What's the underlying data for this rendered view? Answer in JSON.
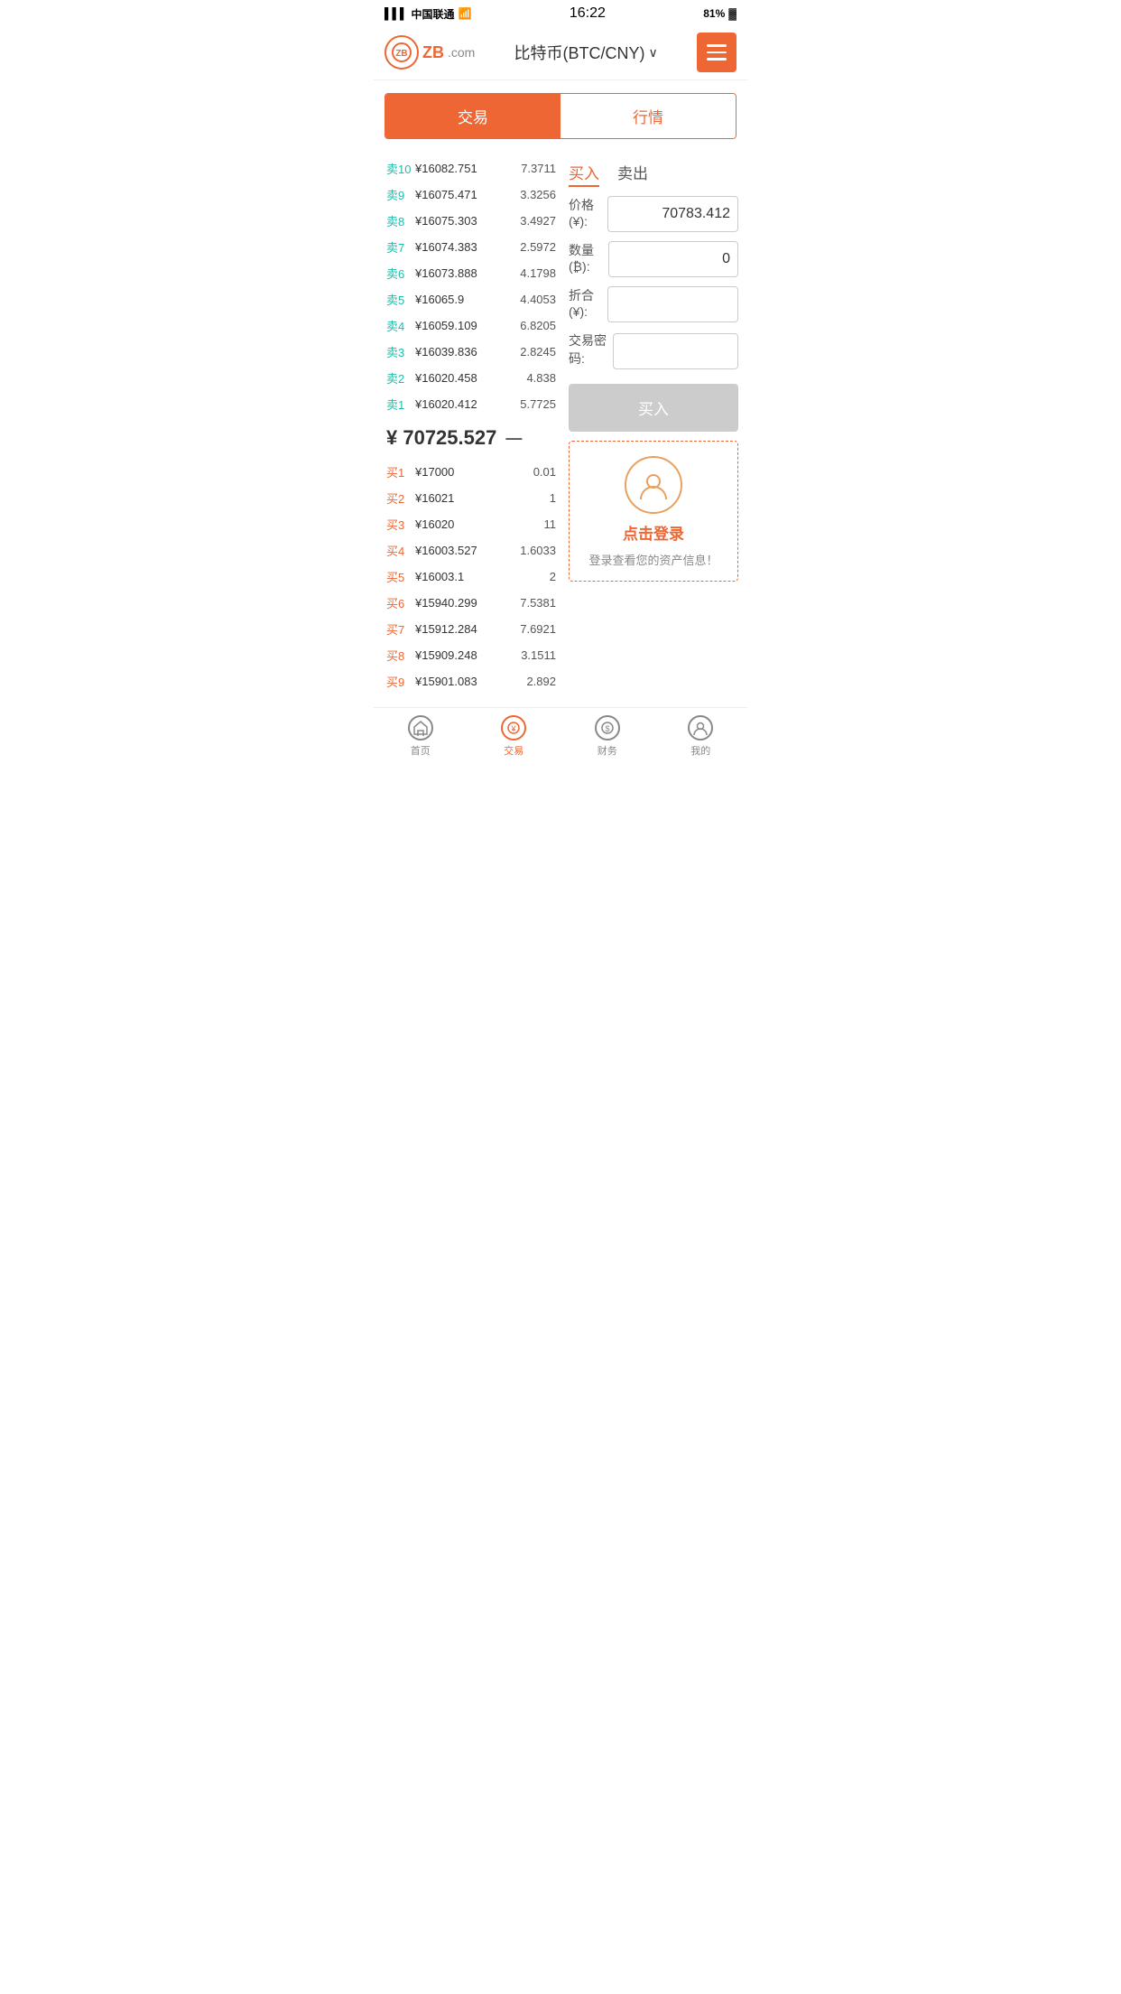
{
  "statusBar": {
    "carrier": "中国联通",
    "time": "16:22",
    "battery": "81%"
  },
  "header": {
    "logo": "ZB",
    "logoSuffix": ".com",
    "title": "比特币(BTC/CNY)",
    "menuLabel": "menu"
  },
  "tabs": {
    "items": [
      {
        "id": "trade",
        "label": "交易",
        "active": true
      },
      {
        "id": "market",
        "label": "行情",
        "active": false
      }
    ]
  },
  "orderBook": {
    "sells": [
      {
        "label": "卖10",
        "price": "¥16082.751",
        "qty": "7.3711"
      },
      {
        "label": "卖9",
        "price": "¥16075.471",
        "qty": "3.3256"
      },
      {
        "label": "卖8",
        "price": "¥16075.303",
        "qty": "3.4927"
      },
      {
        "label": "卖7",
        "price": "¥16074.383",
        "qty": "2.5972"
      },
      {
        "label": "卖6",
        "price": "¥16073.888",
        "qty": "4.1798"
      },
      {
        "label": "卖5",
        "price": "¥16065.9",
        "qty": "4.4053"
      },
      {
        "label": "卖4",
        "price": "¥16059.109",
        "qty": "6.8205"
      },
      {
        "label": "卖3",
        "price": "¥16039.836",
        "qty": "2.8245"
      },
      {
        "label": "卖2",
        "price": "¥16020.458",
        "qty": "4.838"
      },
      {
        "label": "卖1",
        "price": "¥16020.412",
        "qty": "5.7725"
      }
    ],
    "currentPrice": "¥ 70725.527",
    "currentPriceSymbol": "—",
    "buys": [
      {
        "label": "买1",
        "price": "¥17000",
        "qty": "0.01"
      },
      {
        "label": "买2",
        "price": "¥16021",
        "qty": "1"
      },
      {
        "label": "买3",
        "price": "¥16020",
        "qty": "11"
      },
      {
        "label": "买4",
        "price": "¥16003.527",
        "qty": "1.6033"
      },
      {
        "label": "买5",
        "price": "¥16003.1",
        "qty": "2"
      },
      {
        "label": "买6",
        "price": "¥15940.299",
        "qty": "7.5381"
      },
      {
        "label": "买7",
        "price": "¥15912.284",
        "qty": "7.6921"
      },
      {
        "label": "买8",
        "price": "¥15909.248",
        "qty": "3.1511"
      },
      {
        "label": "买9",
        "price": "¥15901.083",
        "qty": "2.892"
      }
    ]
  },
  "tradeForm": {
    "buyTab": "买入",
    "sellTab": "卖出",
    "priceLabel": "价格(¥):",
    "priceValue": "70783.412",
    "qtyLabel": "数量(₿):",
    "qtyValue": "0",
    "totalLabel": "折合(¥):",
    "totalValue": "",
    "passwordLabel": "交易密码:",
    "passwordValue": "",
    "buyButton": "买入"
  },
  "loginArea": {
    "text": "点击登录",
    "subText": "登录查看您的资产信息！"
  },
  "bottomNav": {
    "items": [
      {
        "id": "home",
        "label": "首页",
        "active": false
      },
      {
        "id": "trade",
        "label": "交易",
        "active": true
      },
      {
        "id": "finance",
        "label": "财务",
        "active": false
      },
      {
        "id": "mine",
        "label": "我的",
        "active": false
      }
    ]
  }
}
